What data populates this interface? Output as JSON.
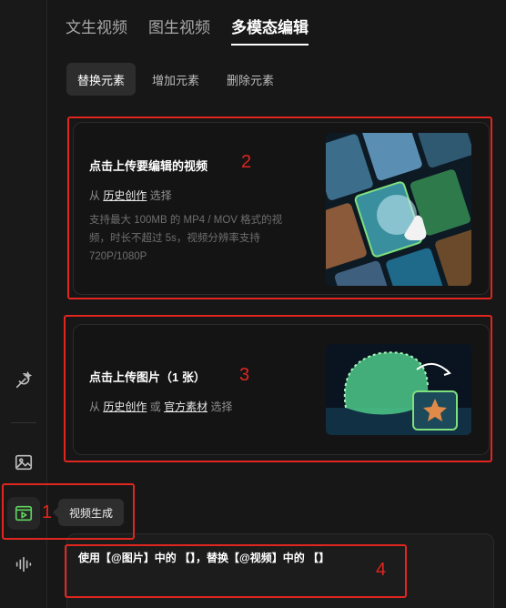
{
  "tabs": [
    "文生视频",
    "图生视频",
    "多模态编辑"
  ],
  "active_tab": "多模态编辑",
  "subtabs": [
    "替换元素",
    "增加元素",
    "删除元素"
  ],
  "upload_video": {
    "title": "点击上传要编辑的视频",
    "from_prefix": "从",
    "history_link": "历史创作",
    "select_suffix": "选择",
    "description": "支持最大 100MB 的 MP4 / MOV 格式的视频，时长不超过 5s，视频分辨率支持 720P/1080P"
  },
  "upload_image": {
    "title": "点击上传图片（1 张）",
    "from_prefix": "从",
    "history_link": "历史创作",
    "or": "或",
    "official_link": "官方素材",
    "select_suffix": "选择"
  },
  "tooltip": "视频生成",
  "prompt": "使用【@图片】中的 【】，替换【@视频】中的 【】",
  "annotations": [
    "1",
    "2",
    "3",
    "4"
  ],
  "colors": {
    "annotation": "#e0261f",
    "active_icon": "#5fd35f",
    "background": "#171717"
  },
  "sidebar_icons": [
    "magic-wand-icon",
    "image-icon",
    "video-generate-icon",
    "audio-wave-icon"
  ]
}
